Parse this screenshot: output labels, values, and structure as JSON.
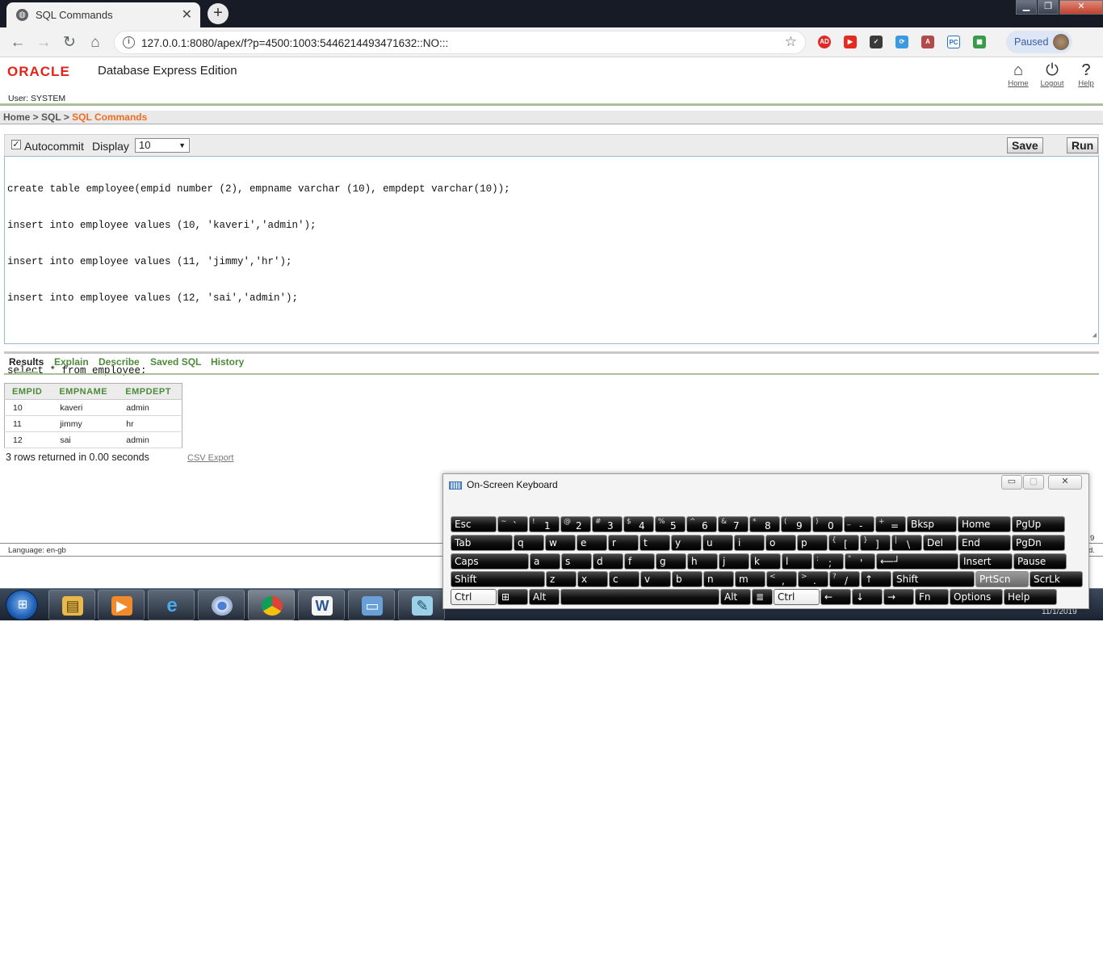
{
  "browser": {
    "tab_title": "SQL Commands",
    "tab_icon": "globe-icon",
    "url": "127.0.0.1:8080/apex/f?p=4500:1003:5446214493471632::NO:::",
    "profile_label": "Paused",
    "extensions": [
      "adblock-icon",
      "youtube-icon",
      "todo-icon",
      "sync-icon",
      "pdf-icon",
      "pc-icon",
      "sheets-icon"
    ]
  },
  "app": {
    "logo": "ORACLE",
    "product": "Database Express Edition",
    "user_label": "User: SYSTEM",
    "top_links": {
      "home": "Home",
      "logout": "Logout",
      "help": "Help"
    },
    "breadcrumb": {
      "home": "Home",
      "sep1": " > ",
      "sql": "SQL",
      "sep2": " > ",
      "current": "SQL Commands"
    }
  },
  "command_bar": {
    "autocommit_label": "Autocommit",
    "autocommit_checked": true,
    "display_label": "Display",
    "display_value": "10",
    "save_label": "Save",
    "run_label": "Run"
  },
  "editor": {
    "lines": [
      "create table employee(empid number (2), empname varchar (10), empdept varchar(10));",
      "insert into employee values (10, 'kaveri','admin');",
      "insert into employee values (11, 'jimmy','hr');",
      "insert into employee values (12, 'sai','admin');",
      "",
      "select * from employee;"
    ]
  },
  "result_tabs": [
    "Results",
    "Explain",
    "Describe",
    "Saved SQL",
    "History"
  ],
  "results": {
    "columns": [
      "EMPID",
      "EMPNAME",
      "EMPDEPT"
    ],
    "rows": [
      [
        "10",
        "kaveri",
        "admin"
      ],
      [
        "11",
        "jimmy",
        "hr"
      ],
      [
        "12",
        "sai",
        "admin"
      ]
    ],
    "summary": "3 rows returned in 0.00 seconds",
    "csv_export": "CSV Export"
  },
  "footer": {
    "language": "Language: en-gb",
    "right_fragment_1": "9",
    "right_fragment_2": "d."
  },
  "taskbar": {
    "apps": [
      "explorer-icon",
      "media-player-icon",
      "internet-explorer-icon",
      "chrome-icon",
      "chrome-icon",
      "word-icon",
      "remote-desktop-icon",
      "notepad-icon"
    ],
    "clock_date": "11/1/2019"
  },
  "osk": {
    "title": "On-Screen Keyboard",
    "rows": [
      [
        {
          "m": "Esc"
        },
        {
          "s": "~",
          "m": "`"
        },
        {
          "s": "!",
          "m": "1"
        },
        {
          "s": "@",
          "m": "2"
        },
        {
          "s": "#",
          "m": "3"
        },
        {
          "s": "$",
          "m": "4"
        },
        {
          "s": "%",
          "m": "5"
        },
        {
          "s": "^",
          "m": "6"
        },
        {
          "s": "&",
          "m": "7"
        },
        {
          "s": "*",
          "m": "8"
        },
        {
          "s": "(",
          "m": "9"
        },
        {
          "s": ")",
          "m": "0"
        },
        {
          "s": "_",
          "m": "-"
        },
        {
          "s": "+",
          "m": "="
        },
        {
          "m": "Bksp"
        },
        {
          "m": "Home"
        },
        {
          "m": "PgUp"
        }
      ],
      [
        {
          "m": "Tab"
        },
        {
          "m": "q"
        },
        {
          "m": "w"
        },
        {
          "m": "e"
        },
        {
          "m": "r"
        },
        {
          "m": "t"
        },
        {
          "m": "y"
        },
        {
          "m": "u"
        },
        {
          "m": "i"
        },
        {
          "m": "o"
        },
        {
          "m": "p"
        },
        {
          "s": "{",
          "m": "["
        },
        {
          "s": "}",
          "m": "]"
        },
        {
          "s": "|",
          "m": "\\"
        },
        {
          "m": "Del"
        },
        {
          "m": "End"
        },
        {
          "m": "PgDn"
        }
      ],
      [
        {
          "m": "Caps"
        },
        {
          "m": "a"
        },
        {
          "m": "s"
        },
        {
          "m": "d"
        },
        {
          "m": "f"
        },
        {
          "m": "g"
        },
        {
          "m": "h"
        },
        {
          "m": "j"
        },
        {
          "m": "k"
        },
        {
          "m": "l"
        },
        {
          "s": ":",
          "m": ";"
        },
        {
          "s": "\"",
          "m": "'"
        },
        {
          "m": "⟵┘"
        },
        {
          "m": "Insert"
        },
        {
          "m": "Pause"
        }
      ],
      [
        {
          "m": "Shift"
        },
        {
          "m": "z"
        },
        {
          "m": "x"
        },
        {
          "m": "c"
        },
        {
          "m": "v"
        },
        {
          "m": "b"
        },
        {
          "m": "n"
        },
        {
          "m": "m"
        },
        {
          "s": "<",
          "m": ","
        },
        {
          "s": ">",
          "m": "."
        },
        {
          "s": "?",
          "m": "/"
        },
        {
          "m": "↑"
        },
        {
          "m": "Shift"
        },
        {
          "m": "PrtScn"
        },
        {
          "m": "ScrLk"
        }
      ],
      [
        {
          "m": "Ctrl"
        },
        {
          "m": "⊞"
        },
        {
          "m": "Alt"
        },
        {
          "m": ""
        },
        {
          "m": "Alt"
        },
        {
          "m": "≣"
        },
        {
          "m": "Ctrl"
        },
        {
          "m": "←"
        },
        {
          "m": "↓"
        },
        {
          "m": "→"
        },
        {
          "m": "Fn"
        },
        {
          "m": "Options"
        },
        {
          "m": "Help"
        }
      ]
    ]
  }
}
